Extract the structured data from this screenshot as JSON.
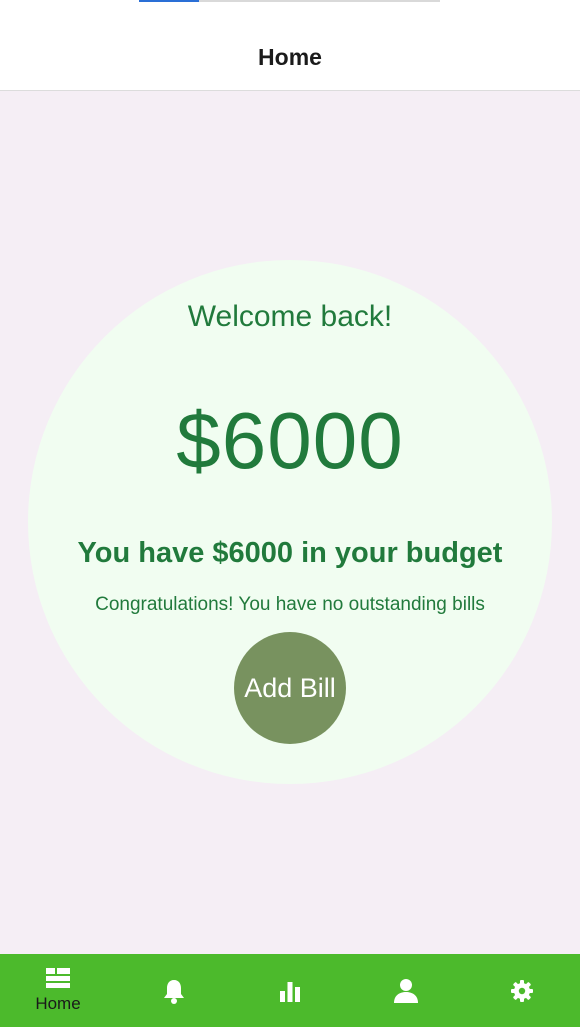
{
  "header": {
    "title": "Home"
  },
  "main": {
    "welcome": "Welcome back!",
    "amount": "$6000",
    "budget_text": "You have $6000 in your budget",
    "bills_text": "Congratulations! You have no outstanding bills",
    "add_bill_label": "Add Bill"
  },
  "tabbar": {
    "tabs": [
      {
        "label": "Home",
        "icon": "home-grid-icon",
        "active": true
      },
      {
        "icon": "bell-icon"
      },
      {
        "icon": "bar-chart-icon"
      },
      {
        "icon": "person-icon"
      },
      {
        "icon": "gear-icon"
      }
    ]
  },
  "colors": {
    "accent_green": "#217a3c",
    "tabbar_green": "#4cba2c",
    "button_green": "#78925f",
    "circle_bg": "#f1fdf1",
    "page_bg": "#f5eef5"
  }
}
